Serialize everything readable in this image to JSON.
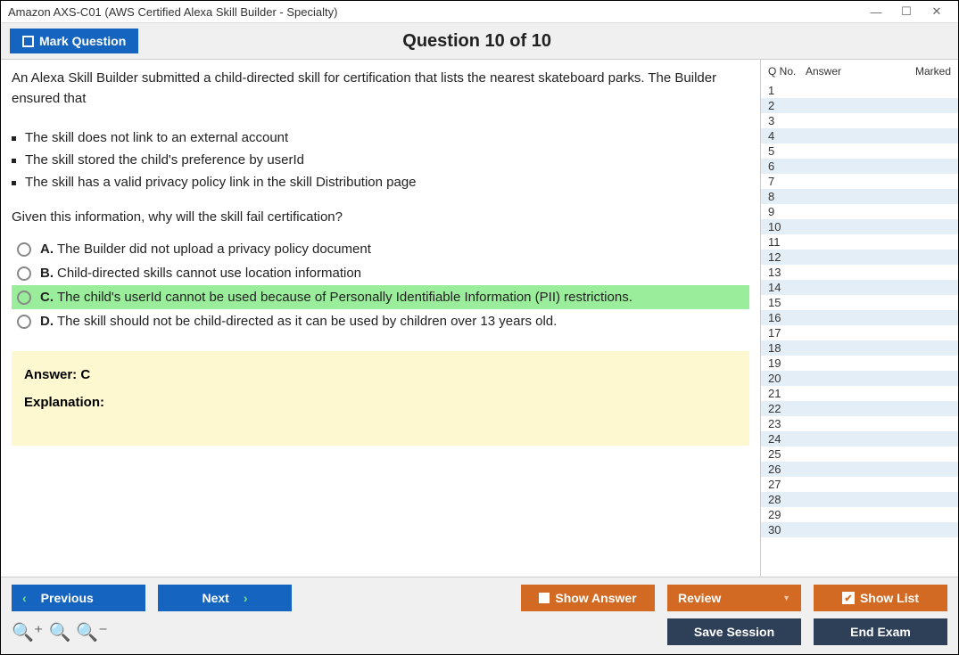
{
  "window": {
    "title": "Amazon AXS-C01 (AWS Certified Alexa Skill Builder - Specialty)"
  },
  "header": {
    "mark_label": "Mark Question",
    "counter": "Question 10 of 10"
  },
  "question": {
    "stem": "An Alexa Skill Builder submitted a child-directed skill for certification that lists the nearest skateboard parks. The Builder ensured that",
    "bullets": [
      "The skill does not link to an external account",
      "The skill stored the child's preference by userId",
      "The skill has a valid privacy policy link in the skill Distribution page"
    ],
    "followup": "Given this information, why will the skill fail certification?",
    "options": [
      {
        "letter": "A.",
        "text": "The Builder did not upload a privacy policy document",
        "correct": false
      },
      {
        "letter": "B.",
        "text": "Child-directed skills cannot use location information",
        "correct": false
      },
      {
        "letter": "C.",
        "text": "The child's userId cannot be used because of Personally Identifiable Information (PII) restrictions.",
        "correct": true
      },
      {
        "letter": "D.",
        "text": "The skill should not be child-directed as it can be used by children over 13 years old.",
        "correct": false
      }
    ],
    "answer_label": "Answer: C",
    "explanation_label": "Explanation:"
  },
  "list_panel": {
    "headers": {
      "qno": "Q No.",
      "answer": "Answer",
      "marked": "Marked"
    },
    "rows": [
      1,
      2,
      3,
      4,
      5,
      6,
      7,
      8,
      9,
      10,
      11,
      12,
      13,
      14,
      15,
      16,
      17,
      18,
      19,
      20,
      21,
      22,
      23,
      24,
      25,
      26,
      27,
      28,
      29,
      30
    ]
  },
  "buttons": {
    "previous": "Previous",
    "next": "Next",
    "show_answer": "Show Answer",
    "review": "Review",
    "show_list": "Show List",
    "save_session": "Save Session",
    "end_exam": "End Exam"
  }
}
